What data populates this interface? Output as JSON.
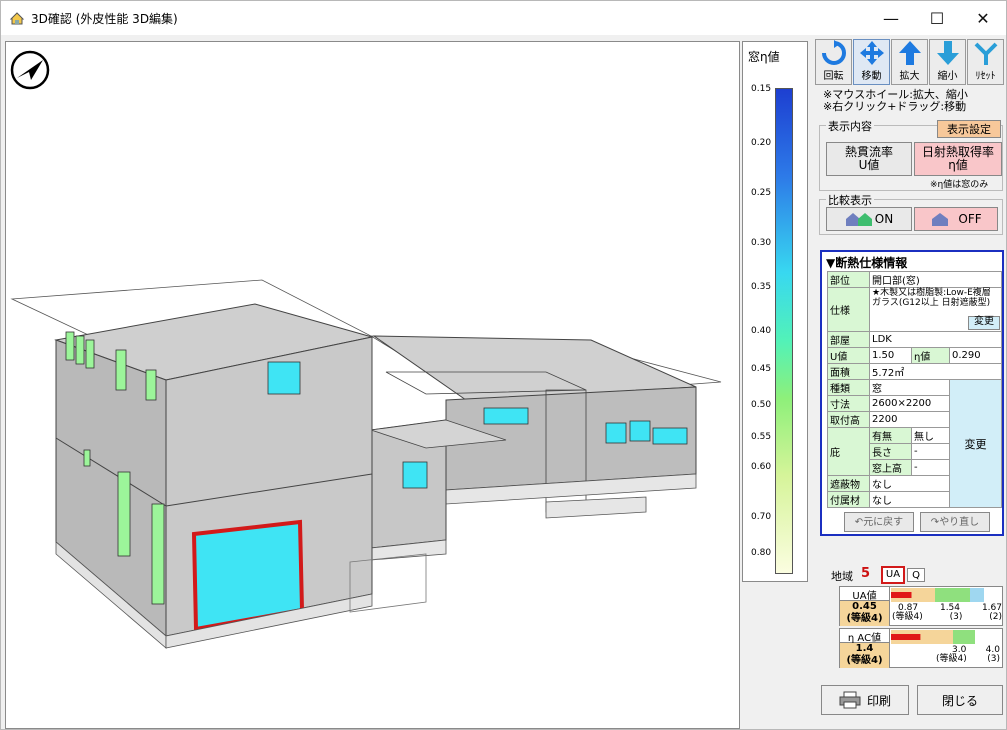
{
  "window": {
    "title": "3D確認 (外皮性能 3D編集)",
    "min": "—",
    "max": "☐",
    "close": "✕"
  },
  "legend": {
    "title": "窓η値",
    "labels": [
      "0.15",
      "0.20",
      "0.25",
      "0.30",
      "0.35",
      "0.40",
      "0.45",
      "0.50",
      "0.55",
      "0.60",
      "0.70",
      "0.80"
    ]
  },
  "toolbar": {
    "rotate": "回転",
    "move": "移動",
    "zoom_in": "拡大",
    "zoom_out": "縮小",
    "reset": "ﾘｾｯﾄ"
  },
  "hints": {
    "line1": "※マウスホイール:拡大、縮小",
    "line2": "※右クリック+ドラッグ:移動"
  },
  "display": {
    "group_label": "表示内容",
    "settings_button": "表示設定",
    "u_button_line1": "熱貫流率",
    "u_button_line2": "U値",
    "eta_button_line1": "日射熱取得率",
    "eta_button_line2": "η値",
    "note": "※η値は窓のみ"
  },
  "compare": {
    "group_label": "比較表示",
    "on": "ON",
    "off": "OFF"
  },
  "spec": {
    "title": "▼断熱仕様情報",
    "part_label": "部位",
    "part_value": "開口部(窓)",
    "spec_label": "仕様",
    "spec_value": "★木製又は樹脂製:Low-E複層ガラス(G12以上 日射遮蔽型)",
    "change": "変更",
    "room_label": "部屋",
    "room_value": "LDK",
    "u_label": "U値",
    "u_value": "1.50",
    "eta_label": "η値",
    "eta_value": "0.290",
    "area_label": "面積",
    "area_value": "5.72㎡",
    "type_label": "種類",
    "type_value": "窓",
    "size_label": "寸法",
    "size_value": "2600×2200",
    "height_label": "取付高",
    "height_value": "2200",
    "eave_label": "庇",
    "eave_has_label": "有無",
    "eave_has_value": "無し",
    "eave_len_label": "長さ",
    "eave_len_value": "-",
    "eave_top_label": "窓上高",
    "eave_top_value": "-",
    "shade_label": "遮蔽物",
    "shade_value": "なし",
    "attach_label": "付属材",
    "attach_value": "なし",
    "change2": "変更",
    "undo": "元に戻す",
    "redo": "やり直し"
  },
  "region": {
    "label": "地域",
    "value": "5",
    "btn_ua": "UA",
    "btn_q": "Q"
  },
  "ua": {
    "head": "UA値",
    "value_line1": "0.45",
    "value_line2": "(等級4)",
    "ticks": [
      "0.87",
      "1.54",
      "1.67"
    ],
    "grades": [
      "(等級4)",
      "(3)",
      "(2)"
    ],
    "fraction": 0.22
  },
  "eta": {
    "head": "η AC値",
    "value_line1": "1.4",
    "value_line2": "(等級4)",
    "ticks": [
      "3.0",
      "4.0"
    ],
    "grades": [
      "(等級4)",
      "(3)"
    ],
    "fraction": 0.35
  },
  "buttons": {
    "print": "印刷",
    "close": "閉じる"
  },
  "colors": {
    "accent_blue": "#1b2fc0",
    "selected_red": "#d21a1a",
    "window_cyan": "#3fe4f4",
    "window_green": "#9cf59a"
  }
}
